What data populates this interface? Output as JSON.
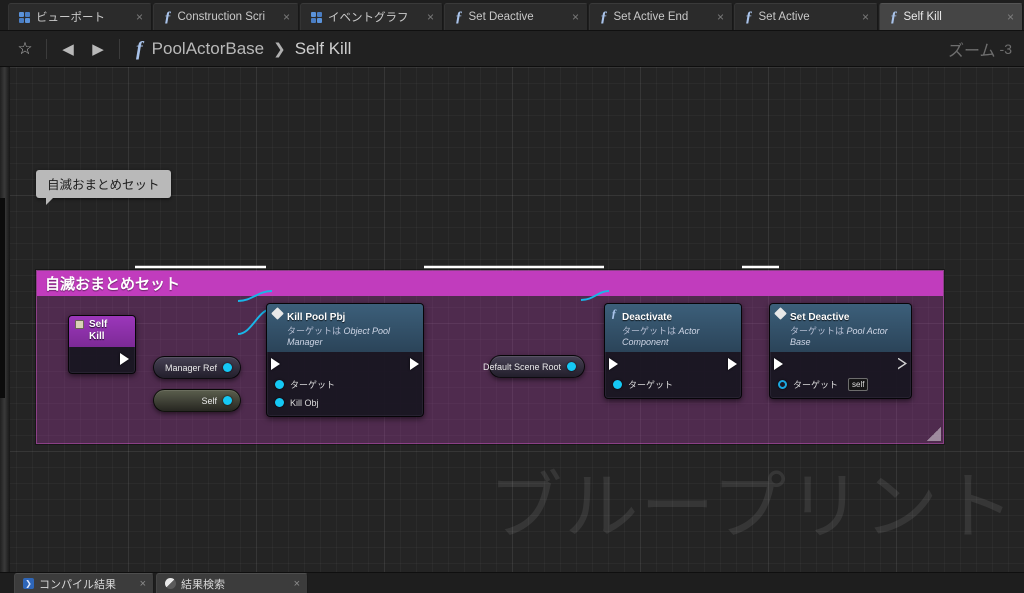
{
  "window": {
    "zoom_label": "ズーム",
    "zoom_value": "-3",
    "watermark": "ブループリント"
  },
  "tabs": [
    {
      "label": "ビューポート",
      "icon": "grid-icon",
      "active": false,
      "close": "×"
    },
    {
      "label": "Construction Scri",
      "icon": "function-icon",
      "active": false,
      "close": "×"
    },
    {
      "label": "イベントグラフ",
      "icon": "grid-icon",
      "active": false,
      "close": "×"
    },
    {
      "label": "Set Deactive",
      "icon": "function-icon",
      "active": false,
      "close": "×"
    },
    {
      "label": "Set Active End",
      "icon": "function-icon",
      "active": false,
      "close": "×"
    },
    {
      "label": "Set Active",
      "icon": "function-icon",
      "active": false,
      "close": "×"
    },
    {
      "label": "Self Kill",
      "icon": "function-icon",
      "active": true,
      "close": "×"
    }
  ],
  "toolbar": {
    "favorite_icon": "☆",
    "back_icon": "◀",
    "forward_icon": "▶",
    "function_icon": "f",
    "breadcrumb": {
      "parent": "PoolActorBase",
      "separator": "❯",
      "current": "Self Kill"
    }
  },
  "graph": {
    "tooltip": "自滅おまとめセット",
    "comment": {
      "title": "自滅おまとめセット",
      "color": "#c13cbd"
    },
    "nodes": [
      {
        "id": "self-kill-event",
        "title": "Self Kill",
        "subtitle": "",
        "kind": "event",
        "exec_out": true
      },
      {
        "id": "kill-pool-obj",
        "title": "Kill Pool Pbj",
        "subtitle_prefix": "ターゲットは",
        "subtitle_class": "Object Pool Manager",
        "kind": "function",
        "inputs": [
          {
            "label": "ターゲット",
            "type": "object"
          },
          {
            "label": "Kill Obj",
            "type": "object"
          }
        ]
      },
      {
        "id": "deactivate",
        "title": "Deactivate",
        "subtitle_prefix": "ターゲットは",
        "subtitle_class": "Actor Component",
        "kind": "function",
        "inputs": [
          {
            "label": "ターゲット",
            "type": "object"
          }
        ]
      },
      {
        "id": "set-deactive",
        "title": "Set Deactive",
        "subtitle_prefix": "ターゲットは",
        "subtitle_class": "Pool Actor Base",
        "kind": "function",
        "inputs": [
          {
            "label": "ターゲット",
            "type": "object",
            "value": "self"
          }
        ]
      }
    ],
    "variables": [
      {
        "id": "manager-ref",
        "label": "Manager Ref"
      },
      {
        "id": "self-ref",
        "label": "Self"
      },
      {
        "id": "default-scene-root",
        "label": "Default Scene Root"
      }
    ],
    "colors": {
      "exec_wire": "#ffffff",
      "data_wire": "#19b6e8",
      "comment": "#c13cbd",
      "event_header": "#8c31a8",
      "function_header": "#35566e"
    }
  },
  "bottom_tabs": [
    {
      "label": "コンパイル結果",
      "icon": "compile-icon",
      "close": "×"
    },
    {
      "label": "結果検索",
      "icon": "find-icon",
      "close": "×"
    }
  ]
}
